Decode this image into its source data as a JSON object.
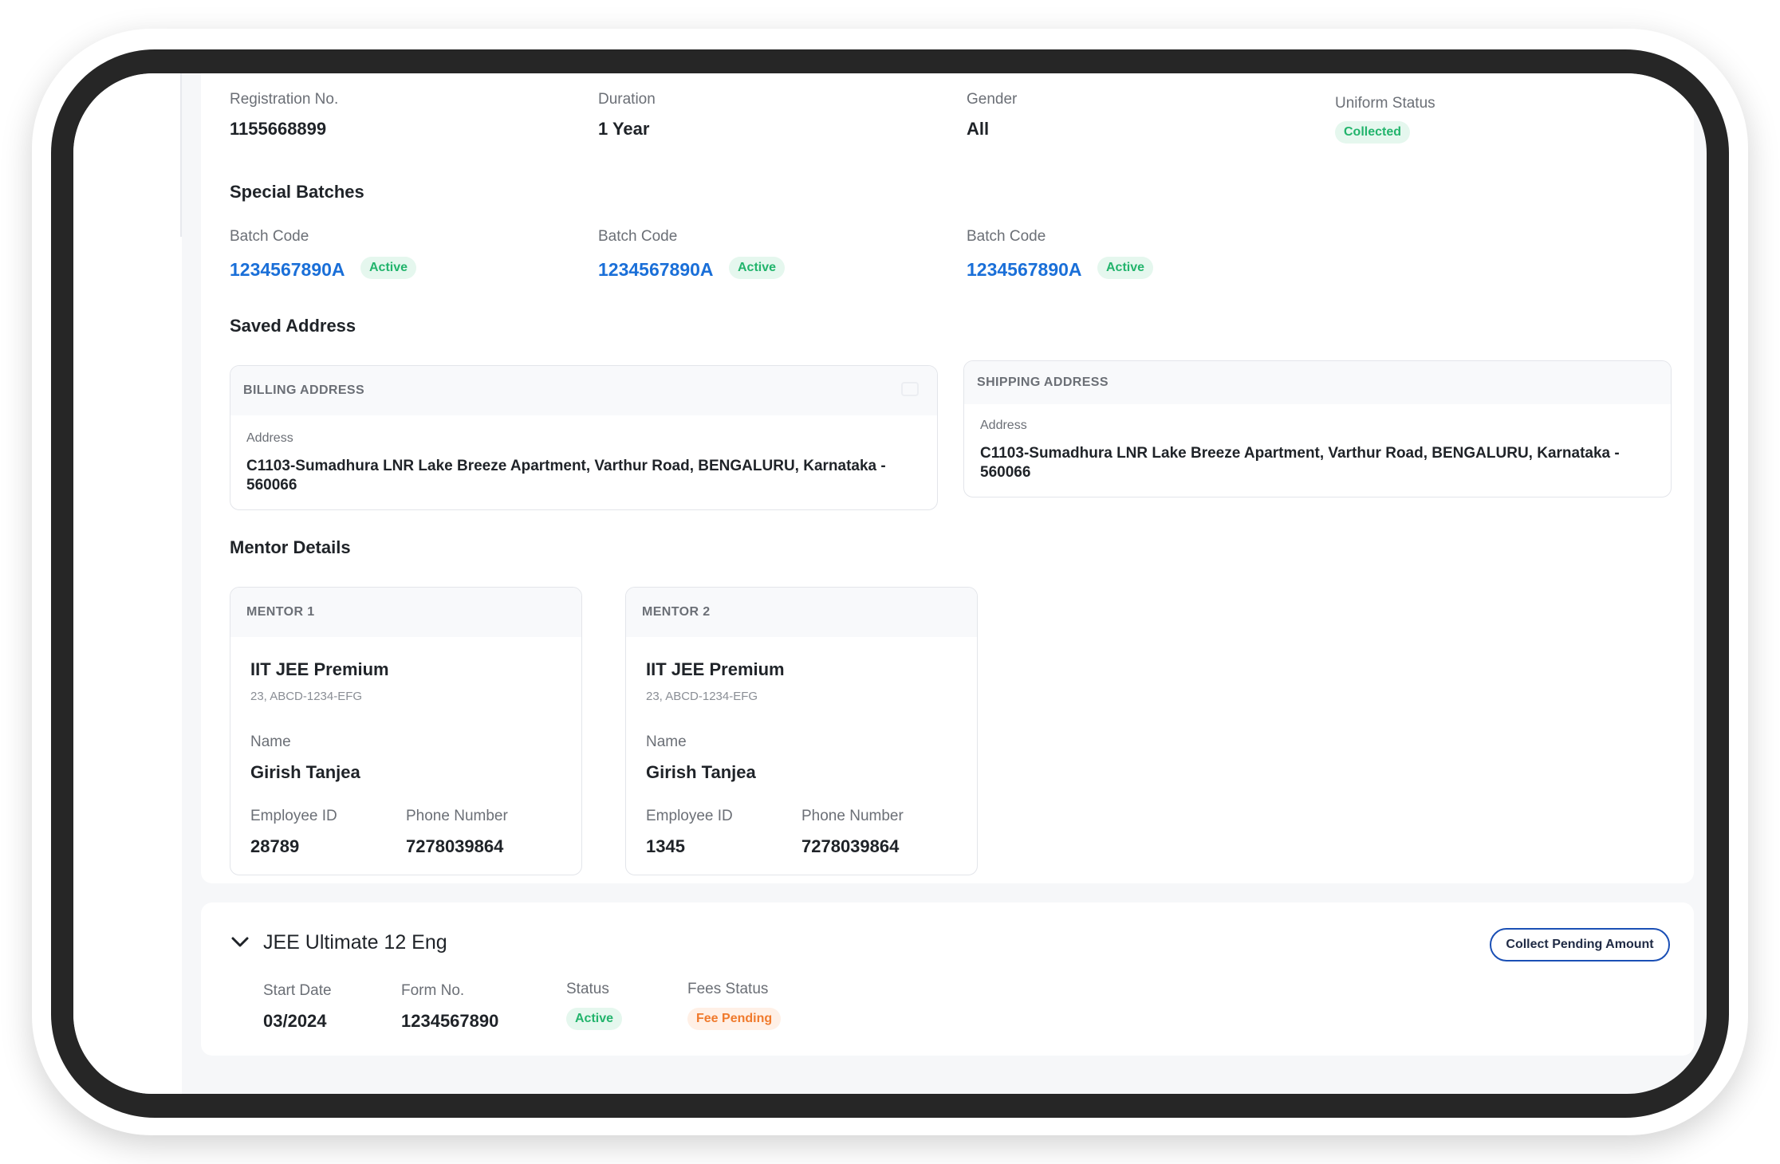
{
  "info_row": {
    "registration_label": "Registration No.",
    "registration_value": "1155668899",
    "duration_label": "Duration",
    "duration_value": "1 Year",
    "gender_label": "Gender",
    "gender_value": "All",
    "uniform_label": "Uniform Status",
    "uniform_badge": "Collected"
  },
  "special_batches": {
    "title": "Special Batches",
    "items": [
      {
        "label": "Batch Code",
        "code": "1234567890A",
        "status": "Active"
      },
      {
        "label": "Batch Code",
        "code": "1234567890A",
        "status": "Active"
      },
      {
        "label": "Batch Code",
        "code": "1234567890A",
        "status": "Active"
      }
    ]
  },
  "saved_address": {
    "title": "Saved Address",
    "billing": {
      "heading": "BILLING ADDRESS",
      "label": "Address",
      "text": "C1103-Sumadhura LNR Lake Breeze Apartment, Varthur Road, BENGALURU, Karnataka - 560066"
    },
    "shipping": {
      "heading": "SHIPPING ADDRESS",
      "label": "Address",
      "text": "C1103-Sumadhura LNR Lake Breeze Apartment, Varthur Road, BENGALURU, Karnataka - 560066"
    }
  },
  "mentor_details": {
    "title": "Mentor Details",
    "mentors": [
      {
        "heading": "MENTOR 1",
        "course": "IIT JEE Premium",
        "code": "23, ABCD-1234-EFG",
        "name_label": "Name",
        "name": "Girish Tanjea",
        "emp_label": "Employee ID",
        "emp_id": "28789",
        "phone_label": "Phone Number",
        "phone": "7278039864"
      },
      {
        "heading": "MENTOR 2",
        "course": "IIT JEE Premium",
        "code": "23, ABCD-1234-EFG",
        "name_label": "Name",
        "name": "Girish Tanjea",
        "emp_label": "Employee ID",
        "emp_id": "1345",
        "phone_label": "Phone Number",
        "phone": "7278039864"
      }
    ]
  },
  "course": {
    "title": "JEE Ultimate 12 Eng",
    "collect_button": "Collect Pending Amount",
    "start_label": "Start Date",
    "start_value": "03/2024",
    "form_label": "Form No.",
    "form_value": "1234567890",
    "status_label": "Status",
    "status_badge": "Active",
    "fees_label": "Fees Status",
    "fees_badge": "Fee Pending"
  },
  "icons": {
    "expand": "chevron-down-icon",
    "edit": "edit-icon"
  },
  "colors": {
    "link": "#1a6fd8",
    "success": "#22b46c",
    "warning": "#f07a2c",
    "button_border": "#1a4fb5"
  }
}
